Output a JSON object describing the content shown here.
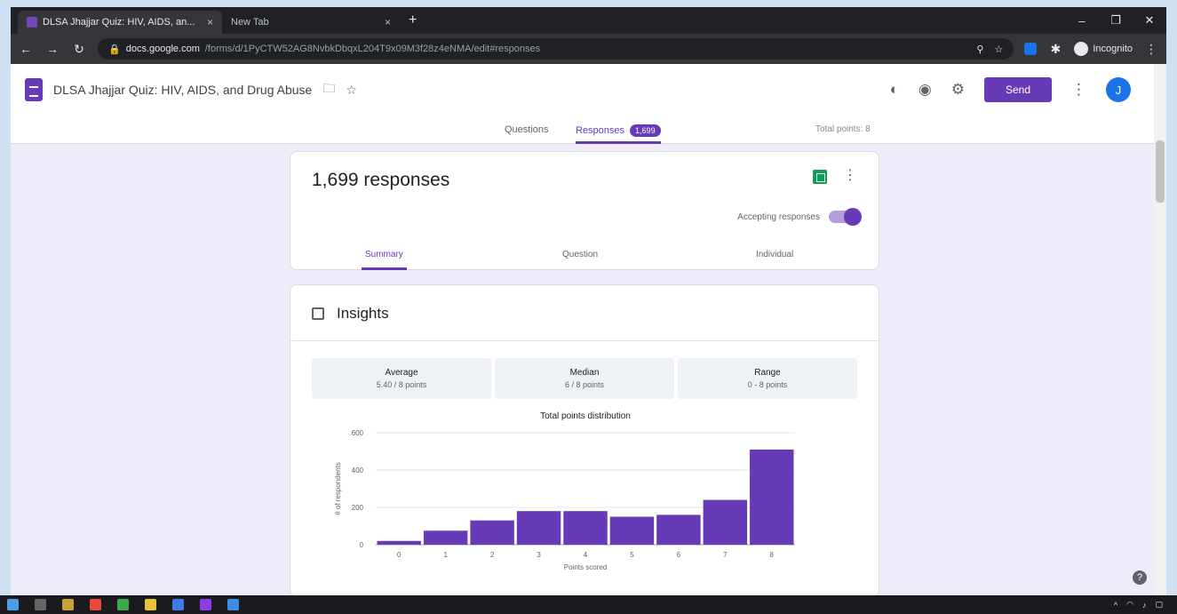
{
  "browser": {
    "tabs": [
      {
        "title": "DLSA Jhajjar Quiz: HIV, AIDS, an...",
        "active": true
      },
      {
        "title": "New Tab",
        "active": false
      }
    ],
    "url_host": "docs.google.com",
    "url_path": "/forms/d/1PyCTW52AG8NvbkDbqxL204T9x09M3f28z4eNMA/edit#responses",
    "profile_label": "Incognito"
  },
  "form": {
    "title": "DLSA Jhajjar Quiz: HIV, AIDS, and Drug Abuse",
    "send_label": "Send",
    "avatar_initial": "J",
    "tabs": {
      "questions": "Questions",
      "responses": "Responses",
      "responses_badge": "1,699",
      "total_points": "Total points: 8"
    }
  },
  "responses": {
    "count_text": "1,699 responses",
    "accepting_label": "Accepting responses",
    "accepting": true,
    "subtabs": {
      "summary": "Summary",
      "question": "Question",
      "individual": "Individual"
    }
  },
  "insights": {
    "title": "Insights",
    "stats": [
      {
        "label": "Average",
        "value": "5.40 / 8 points"
      },
      {
        "label": "Median",
        "value": "6 / 8 points"
      },
      {
        "label": "Range",
        "value": "0 - 8 points"
      }
    ]
  },
  "chart_data": {
    "type": "bar",
    "title": "Total points distribution",
    "xlabel": "Points scored",
    "ylabel": "# of respondents",
    "categories": [
      "0",
      "1",
      "2",
      "3",
      "4",
      "5",
      "6",
      "7",
      "8"
    ],
    "values": [
      20,
      75,
      130,
      180,
      180,
      150,
      160,
      240,
      510
    ],
    "ylim": [
      0,
      600
    ],
    "yticks": [
      0,
      200,
      400,
      600
    ],
    "bar_color": "#673ab7"
  },
  "colors": {
    "accent": "#673ab7",
    "page_bg": "#f0ebf8"
  }
}
